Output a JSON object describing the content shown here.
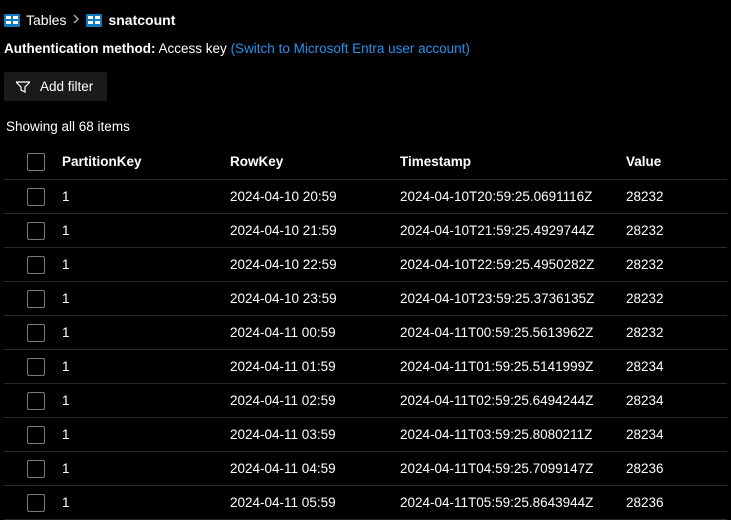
{
  "breadcrumb": {
    "parent": "Tables",
    "current": "snatcount"
  },
  "auth": {
    "label": "Authentication method:",
    "method": "Access key",
    "link": "(Switch to Microsoft Entra user account)"
  },
  "toolbar": {
    "add_filter": "Add filter"
  },
  "showing": "Showing all 68 items",
  "columns": {
    "partitionKey": "PartitionKey",
    "rowKey": "RowKey",
    "timestamp": "Timestamp",
    "value": "Value"
  },
  "rows": [
    {
      "partitionKey": "1",
      "rowKey": "2024-04-10 20:59",
      "timestamp": "2024-04-10T20:59:25.0691116Z",
      "value": "28232"
    },
    {
      "partitionKey": "1",
      "rowKey": "2024-04-10 21:59",
      "timestamp": "2024-04-10T21:59:25.4929744Z",
      "value": "28232"
    },
    {
      "partitionKey": "1",
      "rowKey": "2024-04-10 22:59",
      "timestamp": "2024-04-10T22:59:25.4950282Z",
      "value": "28232"
    },
    {
      "partitionKey": "1",
      "rowKey": "2024-04-10 23:59",
      "timestamp": "2024-04-10T23:59:25.3736135Z",
      "value": "28232"
    },
    {
      "partitionKey": "1",
      "rowKey": "2024-04-11 00:59",
      "timestamp": "2024-04-11T00:59:25.5613962Z",
      "value": "28232"
    },
    {
      "partitionKey": "1",
      "rowKey": "2024-04-11 01:59",
      "timestamp": "2024-04-11T01:59:25.5141999Z",
      "value": "28234"
    },
    {
      "partitionKey": "1",
      "rowKey": "2024-04-11 02:59",
      "timestamp": "2024-04-11T02:59:25.6494244Z",
      "value": "28234"
    },
    {
      "partitionKey": "1",
      "rowKey": "2024-04-11 03:59",
      "timestamp": "2024-04-11T03:59:25.8080211Z",
      "value": "28234"
    },
    {
      "partitionKey": "1",
      "rowKey": "2024-04-11 04:59",
      "timestamp": "2024-04-11T04:59:25.7099147Z",
      "value": "28236"
    },
    {
      "partitionKey": "1",
      "rowKey": "2024-04-11 05:59",
      "timestamp": "2024-04-11T05:59:25.8643944Z",
      "value": "28236"
    }
  ]
}
